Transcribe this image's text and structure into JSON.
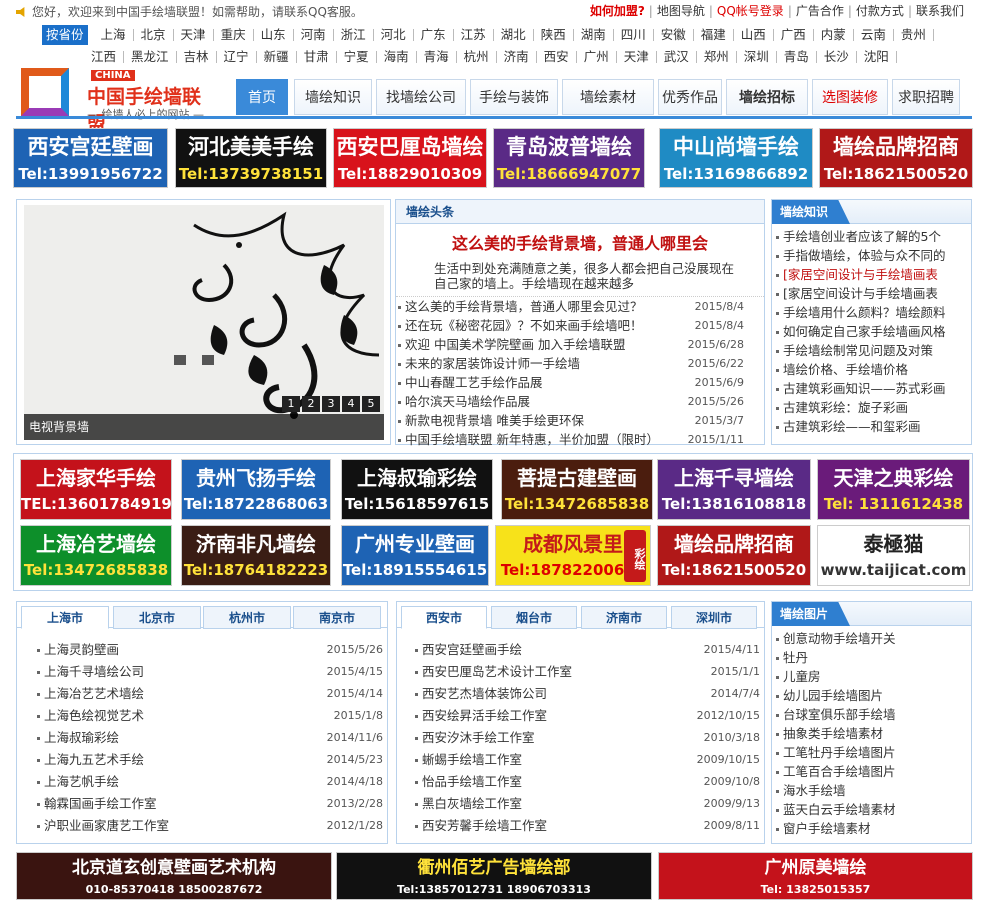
{
  "topbar": {
    "welcome": "您好，欢迎来到中国手绘墙联盟！如需帮助，请联系QQ客服。",
    "links": [
      {
        "label": "如何加盟?",
        "style": "red bold"
      },
      {
        "label": "地图导航",
        "style": ""
      },
      {
        "label": "QQ帐号登录",
        "style": "red"
      },
      {
        "label": "广告合作",
        "style": ""
      },
      {
        "label": "付款方式",
        "style": ""
      },
      {
        "label": "联系我们",
        "style": ""
      }
    ]
  },
  "cities": {
    "tag": "按省份",
    "row1": [
      "上海",
      "北京",
      "天津",
      "重庆",
      "山东",
      "河南",
      "浙江",
      "河北",
      "广东",
      "江苏",
      "湖北",
      "陕西",
      "湖南",
      "四川",
      "安徽",
      "福建",
      "山西",
      "广西",
      "内蒙",
      "云南",
      "贵州"
    ],
    "row2": [
      "江西",
      "黑龙江",
      "吉林",
      "辽宁",
      "新疆",
      "甘肃",
      "宁夏",
      "海南",
      "青海",
      "杭州",
      "济南",
      "西安",
      "广州",
      "天津",
      "武汉",
      "郑州",
      "深圳",
      "青岛",
      "长沙",
      "沈阳"
    ]
  },
  "logo": {
    "china": "CHINA",
    "name": "中国手绘墙联盟",
    "slogan": "— 绘墙人必上的网站 —"
  },
  "nav": [
    {
      "label": "首页",
      "active": true
    },
    {
      "label": "墙绘知识"
    },
    {
      "label": "找墙绘公司"
    },
    {
      "label": "手绘与装饰"
    },
    {
      "label": "墙绘素材"
    },
    {
      "label": "优秀作品"
    },
    {
      "label": "墙绘招标",
      "bold": true
    },
    {
      "label": "选图装修",
      "red": true
    },
    {
      "label": "求职招聘"
    }
  ],
  "ads_row1": [
    {
      "title": "西安宫廷壁画",
      "phone": "Tel:13991956722",
      "bg": "#1e63b4",
      "pc": "#fff"
    },
    {
      "title": "河北美美手绘",
      "phone": "Tel:13739738151",
      "bg": "#111111",
      "pc": "#ffe23a"
    },
    {
      "title": "西安巴厘岛墙绘",
      "phone": "Tel:18829010309",
      "bg": "#d8121b",
      "pc": "#fff"
    },
    {
      "title": "青岛波普墙绘",
      "phone": "Tel:18666947077",
      "bg": "#5a2a86",
      "pc": "#ffe23a"
    },
    {
      "title": "中山尚墙手绘",
      "phone": "Tel:13169866892",
      "bg": "#1f8bc4",
      "pc": "#fff"
    },
    {
      "title": "墙绘品牌招商",
      "phone": "Tel:18621500520",
      "bg": "#b01818",
      "pc": "#fff"
    }
  ],
  "slider": {
    "caption": "电视背景墙",
    "pages": [
      "1",
      "2",
      "3",
      "4",
      "5"
    ]
  },
  "headline": {
    "title": "墙绘头条",
    "main": "这么美的手绘背景墙，普通人哪里会",
    "summary": "生活中到处充满随意之美，很多人都会把自己没展现在自己家的墙上。手绘墙现在越来越多",
    "items": [
      {
        "text": "这么美的手绘背景墙，普通人哪里会见过？",
        "date": "2015/8/4"
      },
      {
        "text": "还在玩《秘密花园》？不如来画手绘墙吧！",
        "date": "2015/8/4"
      },
      {
        "text": "欢迎  中国美术学院壁画  加入手绘墙联盟",
        "date": "2015/6/28"
      },
      {
        "text": "未来的家居装饰设计师一手绘墙",
        "date": "2015/6/22"
      },
      {
        "text": "中山春醒工艺手绘作品展",
        "date": "2015/6/9"
      },
      {
        "text": "哈尔滨天马墙绘作品展",
        "date": "2015/5/26"
      },
      {
        "text": "新款电视背景墙 唯美手绘更环保",
        "date": "2015/3/7"
      },
      {
        "text": "中国手绘墙联盟  新年特惠，半价加盟（限时）",
        "date": "2015/1/11"
      }
    ]
  },
  "knowledge": {
    "title": "墙绘知识",
    "items": [
      "手绘墙创业者应该了解的5个",
      "手指做墙绘，体验与众不同的",
      "[家居空间设计与手绘墙画表",
      "[家居空间设计与手绘墙画表",
      "手绘墙用什么颜料？墙绘颜料",
      "如何确定自己家手绘墙画风格",
      "手绘墙绘制常见问题及对策",
      "墙绘价格、手绘墙价格",
      "古建筑彩画知识——苏式彩画",
      "古建筑彩绘：旋子彩画",
      "古建筑彩绘——和玺彩画"
    ],
    "red": [
      2
    ]
  },
  "ads_row2": [
    {
      "title": "上海家华手绘",
      "phone": "TEL:13601784919",
      "bg": "#c4121b",
      "pc": "#fff"
    },
    {
      "title": "贵州飞扬手绘",
      "phone": "Tel:18722868063",
      "bg": "#1e63b4",
      "pc": "#fff"
    },
    {
      "title": "上海叔瑜彩绘",
      "phone": "Tel:15618597615",
      "bg": "#111111",
      "pc": "#fff"
    },
    {
      "title": "菩提古建壁画",
      "phone": "Tel:13472685838",
      "bg": "#4b1d0e",
      "pc": "#ffe23a"
    },
    {
      "title": "上海千寻墙绘",
      "phone": "Tel:13816108818",
      "bg": "#5a2a86",
      "pc": "#fff"
    },
    {
      "title": "天津之典彩绘",
      "phone": "Tel: 1311612438",
      "bg": "#6a1b7a",
      "pc": "#ffe23a"
    }
  ],
  "ads_row3": [
    {
      "title": "上海冶艺墙绘",
      "phone": "Tel:13472685838",
      "bg": "#0d8f2a",
      "pc": "#ffe23a"
    },
    {
      "title": "济南非凡墙绘",
      "phone": "Tel:18764182223",
      "bg": "#3a1d14",
      "pc": "#ffe23a"
    },
    {
      "title": "广州专业壁画",
      "phone": "Tel:18915554615",
      "bg": "#1e63b4",
      "pc": "#fff"
    },
    {
      "title": "成都风景里",
      "phone": "Tel:18782200625",
      "bg": "#f7e21a",
      "pc": "#d00",
      "tc": "#c41a1a",
      "seal": "彩绘"
    },
    {
      "title": "墙绘品牌招商",
      "phone": "Tel:18621500520",
      "bg": "#b01818",
      "pc": "#fff"
    },
    {
      "title": "泰極猫",
      "phone": "www.taijicat.com",
      "bg": "#ffffff",
      "pc": "#333",
      "tc": "#222"
    }
  ],
  "shanghai": {
    "tabs": [
      "上海市",
      "北京市",
      "杭州市",
      "南京市"
    ],
    "items": [
      {
        "text": "上海灵韵壁画",
        "date": "2015/5/26"
      },
      {
        "text": "上海千寻墙绘公司",
        "date": "2015/4/15"
      },
      {
        "text": "上海冶艺艺术墙绘",
        "date": "2015/4/14"
      },
      {
        "text": "上海色绘视觉艺术",
        "date": "2015/1/8"
      },
      {
        "text": "上海叔瑜彩绘",
        "date": "2014/11/6"
      },
      {
        "text": "上海九五艺术手绘",
        "date": "2014/5/23"
      },
      {
        "text": "上海艺帆手绘",
        "date": "2014/4/18"
      },
      {
        "text": "翰霖国画手绘工作室",
        "date": "2013/2/28"
      },
      {
        "text": "沪职业画家唐艺工作室",
        "date": "2012/1/28"
      }
    ]
  },
  "xian": {
    "tabs": [
      "西安市",
      "烟台市",
      "济南市",
      "深圳市"
    ],
    "items": [
      {
        "text": "西安宫廷壁画手绘",
        "date": "2015/4/11"
      },
      {
        "text": "西安巴厘岛艺术设计工作室",
        "date": "2015/1/1"
      },
      {
        "text": "西安艺杰墙体装饰公司",
        "date": "2014/7/4"
      },
      {
        "text": "西安绘昇活手绘工作室",
        "date": "2012/10/15"
      },
      {
        "text": "西安汐沐手绘工作室",
        "date": "2010/3/18"
      },
      {
        "text": "蜥蜴手绘墙工作室",
        "date": "2009/10/15"
      },
      {
        "text": "怡品手绘墙工作室",
        "date": "2009/10/8"
      },
      {
        "text": "黑白灰墙绘工作室",
        "date": "2009/9/13"
      },
      {
        "text": "西安芳馨手绘墙工作室",
        "date": "2009/8/11"
      }
    ]
  },
  "pictures": {
    "title": "墙绘图片",
    "items": [
      "创意动物手绘墙开关",
      "牡丹",
      "儿童房",
      "幼儿园手绘墙图片",
      "台球室俱乐部手绘墙",
      "抽象类手绘墙素材",
      "工笔牡丹手绘墙图片",
      "工笔百合手绘墙图片",
      "海水手绘墙",
      "蓝天白云手绘墙素材",
      "窗户手绘墙素材"
    ]
  },
  "ads_bottom": [
    {
      "title": "北京道玄创意壁画艺术机构",
      "phone": "010-85370418    18500287672",
      "bg": "#3a1410",
      "pc": "#fff"
    },
    {
      "title": "衢州佰艺广告墙绘部",
      "phone": "Tel:13857012731  18906703313",
      "bg": "#111111",
      "pc": "#fff",
      "tc": "#ffe23a"
    },
    {
      "title": "广州原美墙绘",
      "phone": "Tel: 13825015357",
      "bg": "#c4121b",
      "pc": "#fff"
    }
  ]
}
